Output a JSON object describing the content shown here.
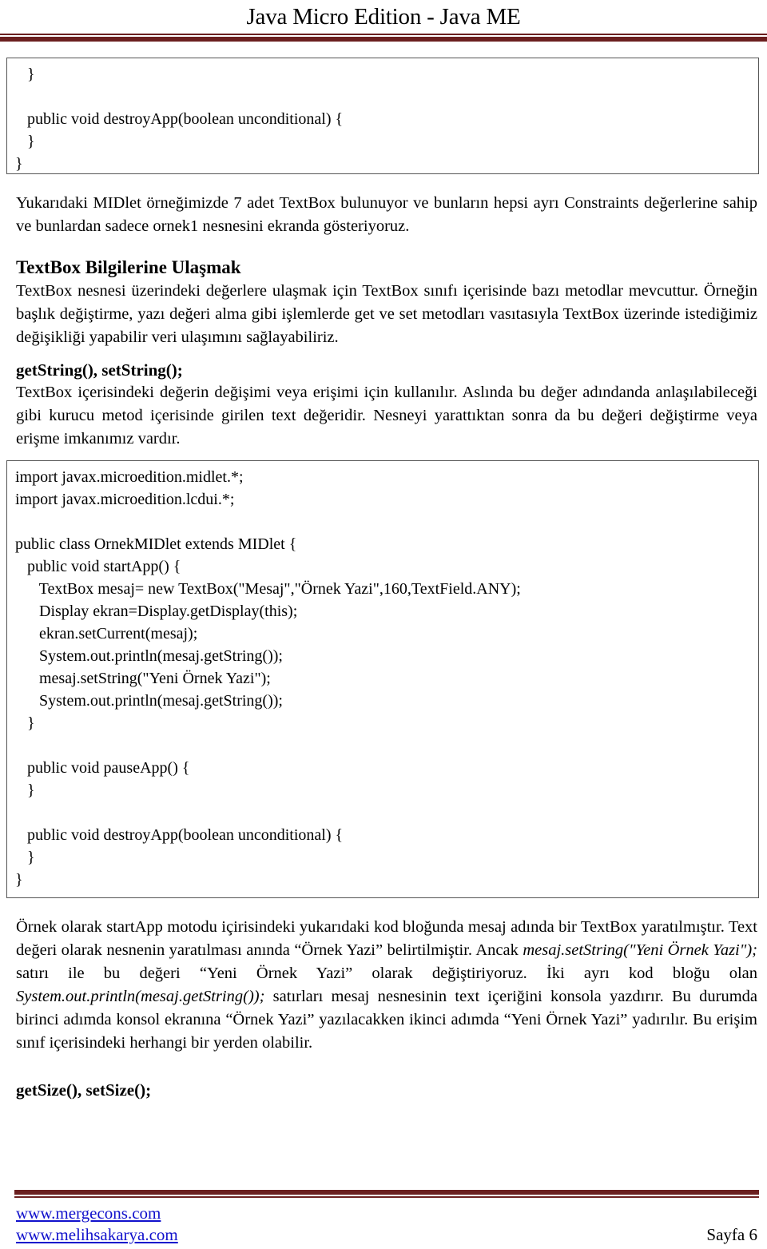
{
  "header": {
    "title": "Java Micro Edition - Java ME",
    "rule_color": "#6b1f1f"
  },
  "code_box_top": {
    "lines": "   }\n\n   public void destroyApp(boolean unconditional) {\n   }\n}"
  },
  "paragraphs": {
    "intro": "Yukarıdaki MIDlet örneğimizde 7 adet TextBox bulunuyor ve bunların hepsi ayrı Constraints değerlerine sahip ve bunlardan sadece ornek1 nesnesini ekranda gösteriyoruz.",
    "section_heading": "TextBox Bilgilerine Ulaşmak",
    "section_body": "TextBox nesnesi üzerindeki değerlere ulaşmak için TextBox sınıfı içerisinde bazı metodlar mevcuttur. Örneğin başlık değiştirme, yazı değeri alma gibi işlemlerde get ve set metodları vasıtasıyla TextBox üzerinde istediğimiz değişikliği yapabilir veri ulaşımını sağlayabiliriz.",
    "sub_heading": "getString(), setString();",
    "sub_body": "TextBox içerisindeki değerin değişimi veya erişimi için kullanılır. Aslında bu değer adındanda anlaşılabileceği gibi kurucu metod içerisinde girilen text değeridir. Nesneyi yarattıktan sonra da bu değeri değiştirme veya erişme imkanımız vardır.",
    "explain_1": "Örnek olarak startApp motodu içirisindeki yukarıdaki kod bloğunda mesaj adında bir TextBox yaratılmıştır. Text değeri olarak nesnenin yaratılması anında “Örnek Yazi” belirtilmiştir. Ancak ",
    "explain_code_1": "mesaj.setString(\"Yeni Örnek Yazi\");",
    "explain_2": " satırı ile bu değeri “Yeni Örnek Yazi” olarak değiştiriyoruz. İki ayrı kod bloğu olan ",
    "explain_code_2": "System.out.println(mesaj.getString());",
    "explain_3": " satırları mesaj nesnesinin text içeriğini konsola yazdırır. Bu durumda birinci adımda konsol ekranına “Örnek Yazi” yazılacakken ikinci adımda “Yeni Örnek Yazi” yadırılır. Bu erişim sınıf içerisindeki herhangi bir yerden olabilir.",
    "final_heading": "getSize(), setSize();"
  },
  "code_box_main": {
    "lines": "import javax.microedition.midlet.*;\nimport javax.microedition.lcdui.*;\n\npublic class OrnekMIDlet extends MIDlet {\n   public void startApp() {\n      TextBox mesaj= new TextBox(\"Mesaj\",\"Örnek Yazi\",160,TextField.ANY);\n      Display ekran=Display.getDisplay(this);\n      ekran.setCurrent(mesaj);\n      System.out.println(mesaj.getString());\n      mesaj.setString(\"Yeni Örnek Yazi\");\n      System.out.println(mesaj.getString());\n   }\n\n   public void pauseApp() {\n   }\n\n   public void destroyApp(boolean unconditional) {\n   }\n}"
  },
  "footer": {
    "link_1": "www.mergecons.com",
    "link_2": "www.melihsakarya.com",
    "page_label": "Sayfa 6",
    "link_color": "#1111cc"
  }
}
